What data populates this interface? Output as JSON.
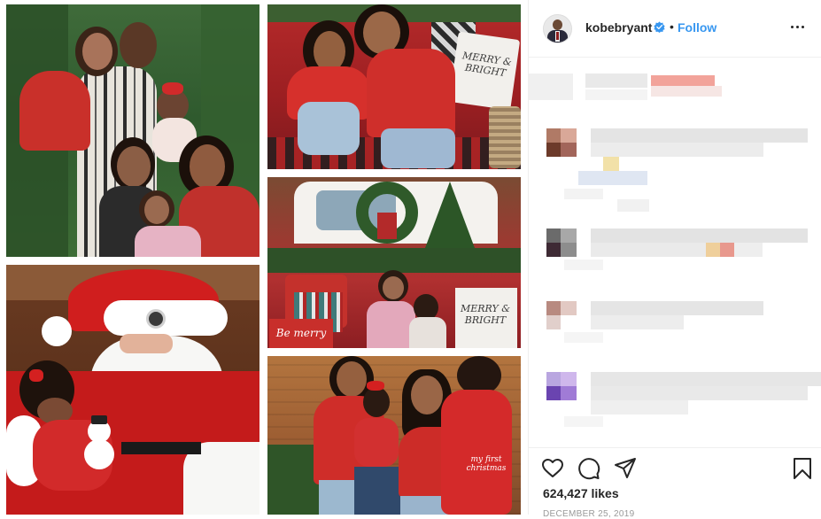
{
  "post": {
    "username": "kobebryant",
    "separator": "•",
    "follow_label": "Follow",
    "likes": "624,427 likes",
    "date": "DECEMBER 25, 2019"
  },
  "photos": {
    "sign_1": "MERRY & BRIGHT",
    "sign_2": "MERRY & BRIGHT",
    "sign_3": "Be merry",
    "shirt_text": "my first christmas"
  },
  "icons": [
    "verified-badge-icon",
    "more-options-icon",
    "heart-icon",
    "comment-icon",
    "share-icon",
    "bookmark-icon"
  ],
  "colors": {
    "accent": "#3897f0",
    "text": "#262626",
    "muted": "#999999",
    "border": "#efefef"
  }
}
